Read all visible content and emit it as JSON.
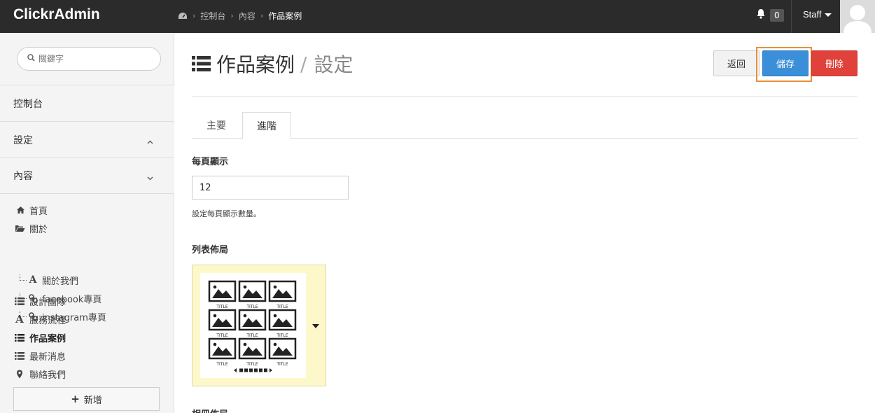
{
  "header": {
    "brand": "ClickrAdmin",
    "breadcrumb": [
      "控制台",
      "內容",
      "作品案例"
    ],
    "notification_count": "0",
    "user_label": "Staff"
  },
  "sidebar": {
    "search_placeholder": "關鍵字",
    "sections": [
      {
        "label": "控制台",
        "chevron": ""
      },
      {
        "label": "設定",
        "chevron": "up"
      },
      {
        "label": "內容",
        "chevron": "down"
      }
    ],
    "tree": [
      {
        "label": "首頁",
        "icon": "home-icon",
        "level": 0
      },
      {
        "label": "關於",
        "icon": "folder-open-icon",
        "level": 0
      },
      {
        "label": "關於我們",
        "icon": "font-icon",
        "level": 1
      },
      {
        "label": "facebook專頁",
        "icon": "link-icon",
        "level": 1
      },
      {
        "label": "instagram專頁",
        "icon": "link-icon",
        "level": 1
      },
      {
        "label": "設計團隊",
        "icon": "list-icon",
        "level": 0
      },
      {
        "label": "服務流程",
        "icon": "font-icon",
        "level": 0
      },
      {
        "label": "作品案例",
        "icon": "list-icon",
        "level": 0,
        "active": true
      },
      {
        "label": "最新消息",
        "icon": "list-icon",
        "level": 0
      },
      {
        "label": "聯絡我們",
        "icon": "map-marker-icon",
        "level": 0
      }
    ],
    "add_label": "新增"
  },
  "main": {
    "title": "作品案例",
    "title_sep": "/",
    "subtitle": "設定",
    "buttons": {
      "back": "返回",
      "save": "儲存",
      "delete": "刪除"
    },
    "tabs": [
      {
        "label": "主要",
        "active": false
      },
      {
        "label": "進階",
        "active": true
      }
    ],
    "per_page": {
      "label": "每頁顯示",
      "value": "12",
      "help": "設定每頁顯示數量。"
    },
    "list_layout": {
      "label": "列表佈局",
      "thumb_caption": "TITLE"
    },
    "next_section_label": "相冊佈局"
  },
  "colors": {
    "topbar": "#2b2b2b",
    "save": "#3a8fd8",
    "delete": "#e0413b",
    "highlight": "#e8913a",
    "layout_bg": "#fdf8c9"
  }
}
